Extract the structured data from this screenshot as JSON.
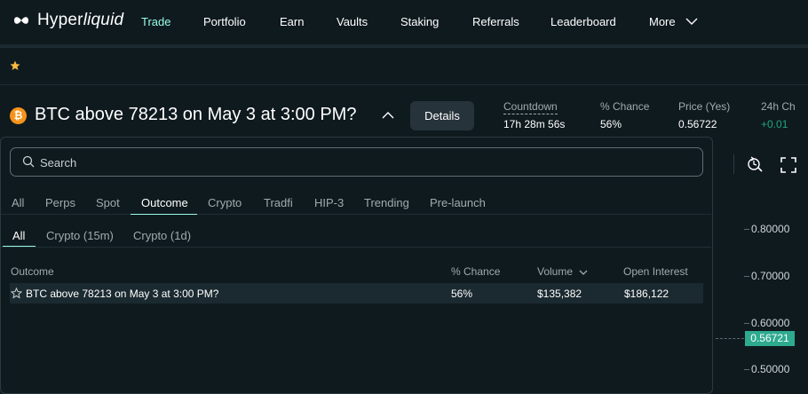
{
  "app": {
    "brand_prefix": "Hyper",
    "brand_suffix": "liquid"
  },
  "nav": {
    "items": [
      {
        "label": "Trade",
        "active": true
      },
      {
        "label": "Portfolio"
      },
      {
        "label": "Earn"
      },
      {
        "label": "Vaults"
      },
      {
        "label": "Staking"
      },
      {
        "label": "Referrals"
      },
      {
        "label": "Leaderboard"
      },
      {
        "label": "More"
      }
    ]
  },
  "market": {
    "coin_symbol": "₿",
    "title": "BTC above 78213 on May 3 at 3:00 PM?",
    "details_label": "Details",
    "stats": [
      {
        "label": "Countdown",
        "value": "17h 28m 56s"
      },
      {
        "label": "% Chance",
        "value": "56%"
      },
      {
        "label": "Price (Yes)",
        "value": "0.56722"
      },
      {
        "label": "24h Ch",
        "value": "+0.01"
      }
    ]
  },
  "search": {
    "placeholder": "Search",
    "value": ""
  },
  "tabs": [
    "All",
    "Perps",
    "Spot",
    "Outcome",
    "Crypto",
    "Tradfi",
    "HIP-3",
    "Trending",
    "Pre-launch"
  ],
  "active_tab": "Outcome",
  "subtabs": [
    "All",
    "Crypto (15m)",
    "Crypto (1d)"
  ],
  "active_subtab": "All",
  "table": {
    "headers": [
      "Outcome",
      "% Chance",
      "Volume",
      "Open Interest"
    ],
    "rows": [
      {
        "outcome": "BTC above 78213 on May 3 at 3:00 PM?",
        "chance": "56%",
        "volume": "$135,382",
        "open_interest": "$186,122"
      }
    ]
  },
  "chart": {
    "price_ticks": [
      "0.80000",
      "0.70000",
      "0.60000",
      "0.50000"
    ],
    "current_price": "0.56721"
  },
  "colors": {
    "background": "#0f1a1f",
    "accent": "#97fce4",
    "bitcoin": "#f7931a",
    "star": "#f5b942",
    "price_badge": "#2eaa8f"
  }
}
